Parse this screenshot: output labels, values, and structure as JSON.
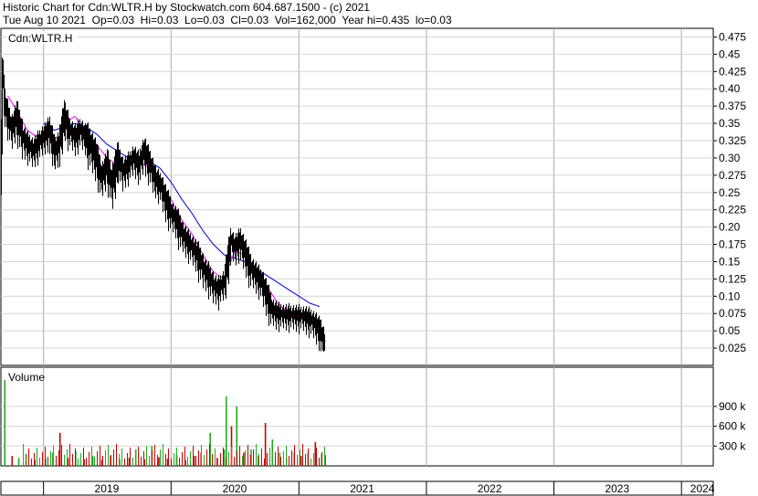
{
  "header": {
    "title_line": "Historic Chart for Cdn:WLTR.H by Stockwatch.com 604.687.1500 - (c) 2021",
    "stats_line": "Tue Aug 10 2021  Op=0.03  Hi=0.03  Lo=0.03  Cl=0.03  Vol=162,000  Year hi=0.435  lo=0.03"
  },
  "chart_data": [
    {
      "type": "candlestick",
      "label": "Cdn:WLTR.H",
      "ylim": [
        0.0,
        0.4875
      ],
      "yticks": [
        "0.475",
        "0.45",
        "0.425",
        "0.40",
        "0.375",
        "0.35",
        "0.325",
        "0.30",
        "0.275",
        "0.25",
        "0.225",
        "0.20",
        "0.175",
        "0.15",
        "0.125",
        "0.10",
        "0.075",
        "0.05",
        "0.025"
      ],
      "ytick_values": [
        0.475,
        0.45,
        0.425,
        0.4,
        0.375,
        0.35,
        0.325,
        0.3,
        0.275,
        0.25,
        0.225,
        0.2,
        0.175,
        0.15,
        0.125,
        0.1,
        0.075,
        0.05,
        0.025
      ],
      "grid": true,
      "ma_colors": {
        "short": "#ff00ff",
        "long": "#0000cc"
      },
      "price_path": [
        [
          "2018-09-01",
          0.3
        ],
        [
          "2018-09-05",
          0.43
        ],
        [
          "2018-09-10",
          0.38
        ],
        [
          "2018-09-20",
          0.36
        ],
        [
          "2018-10-01",
          0.34
        ],
        [
          "2018-10-15",
          0.36
        ],
        [
          "2018-11-01",
          0.33
        ],
        [
          "2018-11-15",
          0.32
        ],
        [
          "2018-12-01",
          0.31
        ],
        [
          "2018-12-15",
          0.32
        ],
        [
          "2019-01-01",
          0.33
        ],
        [
          "2019-01-15",
          0.34
        ],
        [
          "2019-02-01",
          0.31
        ],
        [
          "2019-02-15",
          0.32
        ],
        [
          "2019-03-01",
          0.36
        ],
        [
          "2019-03-15",
          0.34
        ],
        [
          "2019-04-01",
          0.33
        ],
        [
          "2019-04-15",
          0.34
        ],
        [
          "2019-05-01",
          0.33
        ],
        [
          "2019-06-01",
          0.3
        ],
        [
          "2019-06-15",
          0.27
        ],
        [
          "2019-07-01",
          0.29
        ],
        [
          "2019-07-15",
          0.26
        ],
        [
          "2019-08-01",
          0.3
        ],
        [
          "2019-08-15",
          0.28
        ],
        [
          "2019-09-01",
          0.29
        ],
        [
          "2019-09-15",
          0.3
        ],
        [
          "2019-10-01",
          0.29
        ],
        [
          "2019-10-15",
          0.31
        ],
        [
          "2019-11-01",
          0.29
        ],
        [
          "2019-11-15",
          0.27
        ],
        [
          "2019-12-01",
          0.26
        ],
        [
          "2019-12-15",
          0.24
        ],
        [
          "2020-01-01",
          0.22
        ],
        [
          "2020-01-15",
          0.21
        ],
        [
          "2020-02-01",
          0.19
        ],
        [
          "2020-02-15",
          0.18
        ],
        [
          "2020-03-01",
          0.17
        ],
        [
          "2020-03-15",
          0.16
        ],
        [
          "2020-04-01",
          0.14
        ],
        [
          "2020-04-15",
          0.13
        ],
        [
          "2020-05-01",
          0.115
        ],
        [
          "2020-05-15",
          0.11
        ],
        [
          "2020-06-01",
          0.12
        ],
        [
          "2020-06-10",
          0.15
        ],
        [
          "2020-06-20",
          0.18
        ],
        [
          "2020-07-01",
          0.17
        ],
        [
          "2020-07-15",
          0.18
        ],
        [
          "2020-08-01",
          0.16
        ],
        [
          "2020-08-15",
          0.14
        ],
        [
          "2020-09-01",
          0.13
        ],
        [
          "2020-09-15",
          0.12
        ],
        [
          "2020-10-01",
          0.1
        ],
        [
          "2020-10-15",
          0.08
        ],
        [
          "2020-11-01",
          0.075
        ],
        [
          "2020-11-15",
          0.073
        ],
        [
          "2020-12-01",
          0.073
        ],
        [
          "2020-12-15",
          0.072
        ],
        [
          "2021-01-01",
          0.071
        ],
        [
          "2021-01-15",
          0.07
        ],
        [
          "2021-02-01",
          0.066
        ],
        [
          "2021-02-15",
          0.06
        ],
        [
          "2021-03-01",
          0.05
        ],
        [
          "2021-03-15",
          0.03
        ]
      ],
      "ma_short": [
        [
          "2018-09-20",
          0.39
        ],
        [
          "2018-10-15",
          0.37
        ],
        [
          "2018-11-15",
          0.34
        ],
        [
          "2018-12-15",
          0.33
        ],
        [
          "2019-01-15",
          0.33
        ],
        [
          "2019-02-15",
          0.33
        ],
        [
          "2019-03-15",
          0.355
        ],
        [
          "2019-04-01",
          0.36
        ],
        [
          "2019-05-01",
          0.34
        ],
        [
          "2019-06-01",
          0.32
        ],
        [
          "2019-07-01",
          0.3
        ],
        [
          "2019-08-01",
          0.29
        ],
        [
          "2019-09-01",
          0.29
        ],
        [
          "2019-10-01",
          0.295
        ],
        [
          "2019-11-01",
          0.285
        ],
        [
          "2019-12-01",
          0.265
        ],
        [
          "2020-01-01",
          0.24
        ],
        [
          "2020-02-01",
          0.21
        ],
        [
          "2020-03-01",
          0.19
        ],
        [
          "2020-04-01",
          0.16
        ],
        [
          "2020-05-01",
          0.135
        ],
        [
          "2020-06-01",
          0.125
        ],
        [
          "2020-07-01",
          0.165
        ],
        [
          "2020-08-01",
          0.16
        ],
        [
          "2020-09-01",
          0.14
        ],
        [
          "2020-10-01",
          0.115
        ],
        [
          "2020-11-01",
          0.09
        ],
        [
          "2020-12-01",
          0.077
        ],
        [
          "2021-01-01",
          0.074
        ],
        [
          "2021-02-01",
          0.07
        ],
        [
          "2021-03-01",
          0.06
        ]
      ],
      "ma_long": [
        [
          "2019-01-01",
          0.35
        ],
        [
          "2019-02-01",
          0.34
        ],
        [
          "2019-03-01",
          0.345
        ],
        [
          "2019-04-01",
          0.35
        ],
        [
          "2019-05-01",
          0.345
        ],
        [
          "2019-06-01",
          0.335
        ],
        [
          "2019-07-01",
          0.32
        ],
        [
          "2019-08-01",
          0.31
        ],
        [
          "2019-09-01",
          0.3
        ],
        [
          "2019-10-01",
          0.3
        ],
        [
          "2019-11-01",
          0.295
        ],
        [
          "2019-12-01",
          0.285
        ],
        [
          "2020-01-01",
          0.265
        ],
        [
          "2020-02-01",
          0.24
        ],
        [
          "2020-03-01",
          0.22
        ],
        [
          "2020-04-01",
          0.195
        ],
        [
          "2020-05-01",
          0.175
        ],
        [
          "2020-06-01",
          0.16
        ],
        [
          "2020-07-01",
          0.155
        ],
        [
          "2020-08-01",
          0.15
        ],
        [
          "2020-09-01",
          0.14
        ],
        [
          "2020-10-01",
          0.13
        ],
        [
          "2020-11-01",
          0.12
        ],
        [
          "2020-12-01",
          0.11
        ],
        [
          "2021-01-01",
          0.1
        ],
        [
          "2021-02-01",
          0.09
        ],
        [
          "2021-03-01",
          0.085
        ]
      ]
    },
    {
      "type": "bar",
      "label": "Volume",
      "ylim": [
        0,
        1300000
      ],
      "yticks": [
        "900 k",
        "600 k",
        "300 k"
      ],
      "ytick_values": [
        900000,
        600000,
        300000
      ],
      "volume": [
        [
          "2018-09-10",
          1300000,
          "#22aa22"
        ],
        [
          "2018-10-01",
          150000,
          "#cc0000"
        ],
        [
          "2018-10-20",
          120000,
          "#22aa22"
        ],
        [
          "2018-11-10",
          180000,
          "#cc0000"
        ],
        [
          "2018-12-05",
          90000,
          "#cc0000"
        ],
        [
          "2019-01-05",
          110000,
          "#22aa22"
        ],
        [
          "2019-01-25",
          200000,
          "#22aa22"
        ],
        [
          "2019-02-15",
          500000,
          "#cc0000"
        ],
        [
          "2019-03-10",
          120000,
          "#cc0000"
        ],
        [
          "2019-04-01",
          220000,
          "#22aa22"
        ],
        [
          "2019-04-25",
          100000,
          "#cc0000"
        ],
        [
          "2019-05-20",
          150000,
          "#22aa22"
        ],
        [
          "2019-06-15",
          90000,
          "#cc0000"
        ],
        [
          "2019-07-10",
          150000,
          "#cc0000"
        ],
        [
          "2019-08-05",
          100000,
          "#22aa22"
        ],
        [
          "2019-09-01",
          120000,
          "#cc0000"
        ],
        [
          "2019-09-20",
          250000,
          "#22aa22"
        ],
        [
          "2019-10-15",
          100000,
          "#cc0000"
        ],
        [
          "2019-11-05",
          300000,
          "#22aa22"
        ],
        [
          "2019-11-25",
          130000,
          "#cc0000"
        ],
        [
          "2019-12-20",
          110000,
          "#cc0000"
        ],
        [
          "2020-01-15",
          160000,
          "#cc0000"
        ],
        [
          "2020-02-10",
          90000,
          "#22aa22"
        ],
        [
          "2020-03-05",
          150000,
          "#cc0000"
        ],
        [
          "2020-03-25",
          200000,
          "#cc0000"
        ],
        [
          "2020-04-20",
          500000,
          "#22aa22"
        ],
        [
          "2020-05-10",
          120000,
          "#cc0000"
        ],
        [
          "2020-05-30",
          250000,
          "#22aa22"
        ],
        [
          "2020-06-05",
          1050000,
          "#22aa22"
        ],
        [
          "2020-06-20",
          600000,
          "#cc0000"
        ],
        [
          "2020-07-05",
          900000,
          "#22aa22"
        ],
        [
          "2020-07-25",
          200000,
          "#cc0000"
        ],
        [
          "2020-08-15",
          250000,
          "#22aa22"
        ],
        [
          "2020-09-05",
          150000,
          "#cc0000"
        ],
        [
          "2020-09-25",
          650000,
          "#cc0000"
        ],
        [
          "2020-10-15",
          400000,
          "#22aa22"
        ],
        [
          "2020-11-05",
          200000,
          "#22aa22"
        ],
        [
          "2020-11-25",
          120000,
          "#aaaaaa"
        ],
        [
          "2020-12-15",
          200000,
          "#aaaaaa"
        ],
        [
          "2021-01-05",
          150000,
          "#cc0000"
        ],
        [
          "2021-01-25",
          200000,
          "#22aa22"
        ],
        [
          "2021-02-15",
          360000,
          "#cc0000"
        ],
        [
          "2021-03-05",
          180000,
          "#22aa22"
        ],
        [
          "2021-03-15",
          162000,
          "#cc0000"
        ]
      ]
    }
  ],
  "x_axis": {
    "labels": [
      "2019",
      "2020",
      "2021",
      "2022",
      "2023",
      "2024"
    ],
    "label_dates": [
      "2019-07-01",
      "2020-07-01",
      "2021-07-01",
      "2022-07-01",
      "2023-07-01",
      "2024-03-01"
    ],
    "boundaries": [
      "2019-01-01",
      "2020-01-01",
      "2021-01-01",
      "2022-01-01",
      "2023-01-01",
      "2024-01-01"
    ],
    "start": "2018-09-01",
    "end": "2024-04-01"
  }
}
